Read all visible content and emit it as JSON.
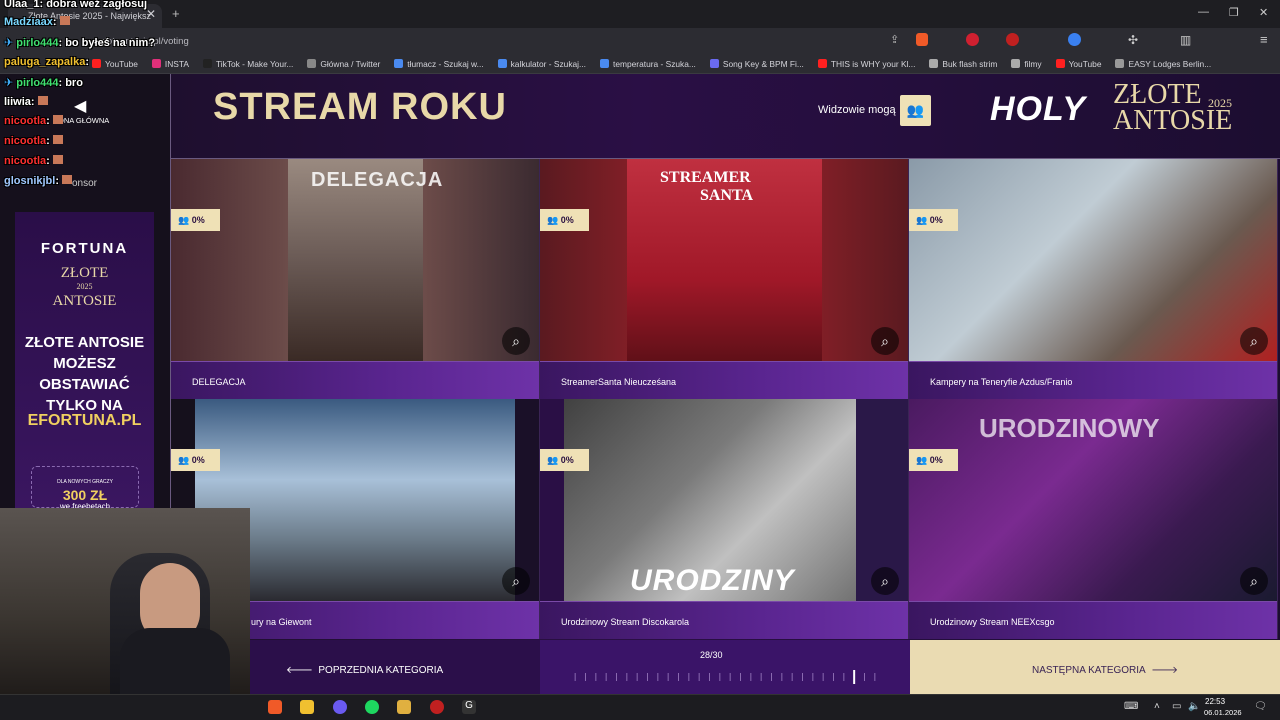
{
  "browser": {
    "tab_title": "Złote Antosie 2025 - Największ",
    "url": "zloteantosie.pl/voting",
    "bookmarks": [
      {
        "label": "YouTube",
        "color": "#ff2020"
      },
      {
        "label": "INSTA",
        "color": "#e0307a"
      },
      {
        "label": "TikTok - Make Your...",
        "color": "#222222"
      },
      {
        "label": "Główna / Twitter",
        "color": "#888888"
      },
      {
        "label": "tłumacz - Szukaj w...",
        "color": "#4a8af0"
      },
      {
        "label": "kalkulator - Szukaj...",
        "color": "#4a8af0"
      },
      {
        "label": "temperatura - Szuka...",
        "color": "#4a8af0"
      },
      {
        "label": "Song Key & BPM Fi...",
        "color": "#6a6af0"
      },
      {
        "label": "THIS is WHY your Kl...",
        "color": "#ff2020"
      },
      {
        "label": "Buk flash strim",
        "color": "#aaaaaa"
      },
      {
        "label": "filmy",
        "color": "#aaaaaa"
      },
      {
        "label": "YouTube",
        "color": "#ff2020"
      },
      {
        "label": "EASY Lodges Berlin...",
        "color": "#999999"
      }
    ]
  },
  "page": {
    "title": "STREAM ROKU",
    "viewers_label": "Widzowie mogą",
    "logo_holy": "HOLY",
    "logo_zlote": "ZŁOTE",
    "logo_antosie": "ANTOSIE",
    "logo_year": "2025"
  },
  "cards": [
    {
      "name": "DELEGACJA",
      "percent": "0%"
    },
    {
      "name": "StreamerSanta Nieucześana",
      "percent": "0%"
    },
    {
      "name": "Kampery na Teneryfie Azdus/Franio",
      "percent": "0%"
    },
    {
      "name": "ury na Giewont",
      "percent": "0%"
    },
    {
      "name": "Urodzinowy Stream Discokarola",
      "percent": "0%"
    },
    {
      "name": "Urodzinowy Stream NEEXcsgo",
      "percent": "0%"
    }
  ],
  "nav": {
    "prev_label": "POPRZEDNIA KATEGORIA",
    "next_label": "NASTĘPNA KATEGORIA",
    "progress_label": "28/30",
    "progress_current": 28,
    "progress_total": 30
  },
  "chat": [
    {
      "user": "Ulaa_1",
      "msg": ": dobra weź zagłosuj",
      "color": "#ffffff"
    },
    {
      "user": "Madziaax",
      "msg": ":",
      "color": "#7ad8ff"
    },
    {
      "user": "pirlo444",
      "msg": ": bo byłeś na nim?",
      "color": "#40e070"
    },
    {
      "user": "paluga_zapalka",
      "msg": ":",
      "color": "#f0c030"
    },
    {
      "user": "pirlo444",
      "msg": ": bro",
      "color": "#40e070"
    },
    {
      "user": "liiwia",
      "msg": ":",
      "color": "#ffffff"
    },
    {
      "user": "nicootla",
      "msg": ":",
      "color": "#ff3030"
    },
    {
      "user": "nicootla",
      "msg": ":",
      "color": "#ff3030"
    },
    {
      "user": "nicootla",
      "msg": ":",
      "color": "#ff3030"
    },
    {
      "user": "glosnikjbl",
      "msg": ":",
      "color": "#a0c8ff"
    }
  ],
  "page_bits": {
    "home_link": "ONA GŁÓWNA",
    "sponsor": "onsor"
  },
  "ad": {
    "brand": "FORTUNA",
    "zlote": "ZŁOTE",
    "antosie": "ANTOSIE",
    "year": "2025",
    "main_line1": "ZŁOTE ANTOSIE",
    "main_line2": "MOŻESZ",
    "main_line3": "OBSTAWIAĆ",
    "main_line4": "TYLKO NA",
    "site": "EFORTUNA.PL",
    "box_small": "DLA NOWYCH GRACZY",
    "box_amount": "300 ZŁ",
    "box_sub": "we freebetach"
  },
  "taskbar": {
    "time": "22:53",
    "date": "06.01.2026"
  }
}
